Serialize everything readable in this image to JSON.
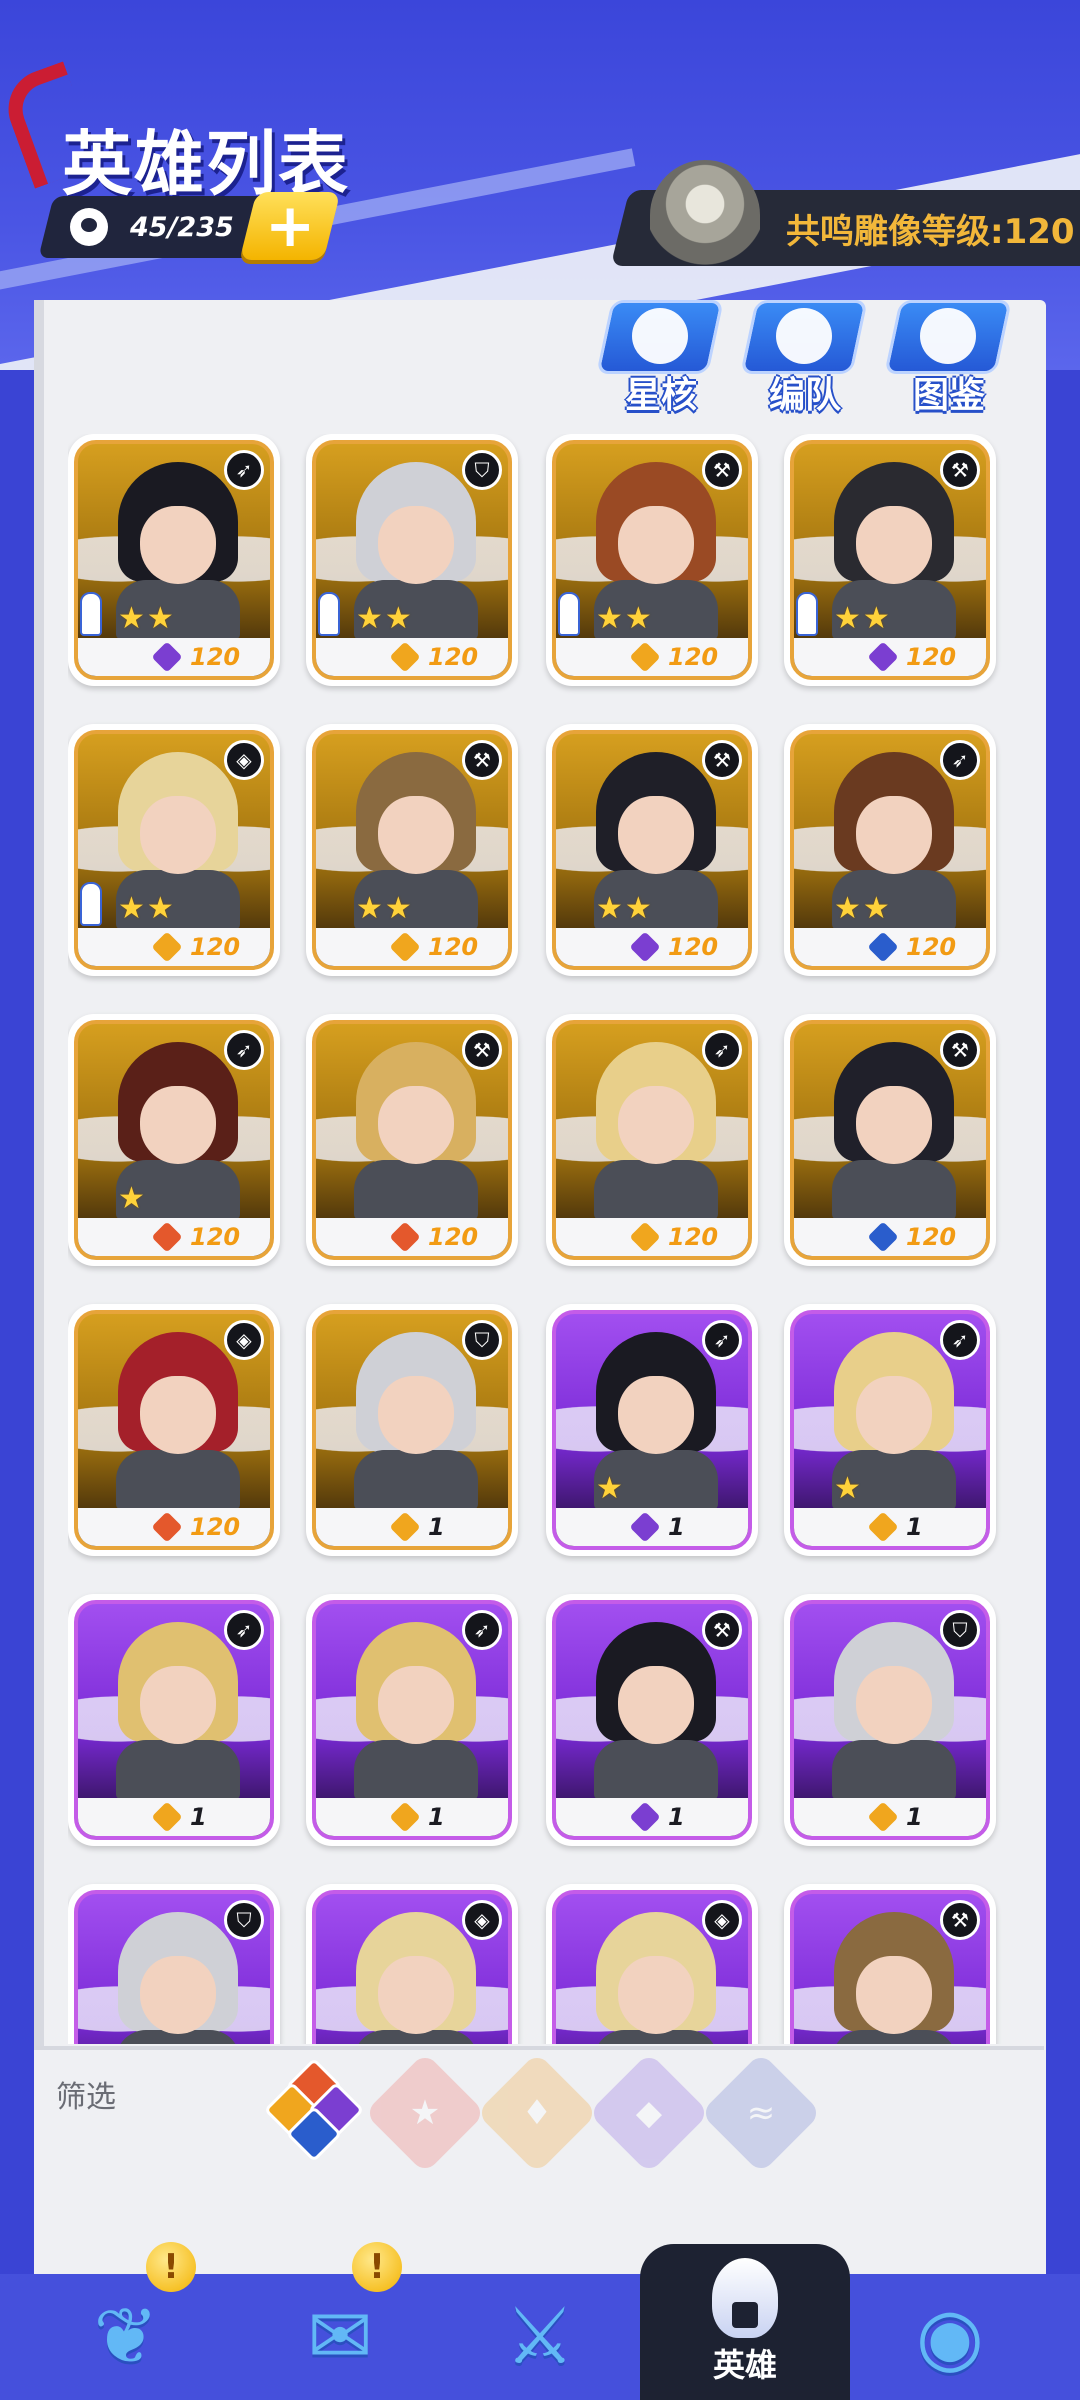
{
  "header": {
    "title": "英雄列表",
    "hero_count": "45/235",
    "plus_icon": "plus-icon",
    "statue_label": "共鸣雕像等级:120"
  },
  "top_buttons": [
    {
      "label": "星核",
      "icon": "planet-icon"
    },
    {
      "label": "编队",
      "icon": "team-icon"
    },
    {
      "label": "图鉴",
      "icon": "book-icon"
    }
  ],
  "heroes": [
    {
      "frame": "gold",
      "class_icon": "bow-icon",
      "stars": 2,
      "element": "purple",
      "level": "120",
      "locked_person": true
    },
    {
      "frame": "gold",
      "class_icon": "shield-icon",
      "stars": 2,
      "element": "gold",
      "level": "120",
      "locked_person": true
    },
    {
      "frame": "gold",
      "class_icon": "axe-icon",
      "stars": 2,
      "element": "gold",
      "level": "120",
      "locked_person": true
    },
    {
      "frame": "gold",
      "class_icon": "axe-icon",
      "stars": 2,
      "element": "purple",
      "level": "120",
      "locked_person": true
    },
    {
      "frame": "gold",
      "class_icon": "magic-icon",
      "stars": 2,
      "element": "gold",
      "level": "120",
      "locked_person": true
    },
    {
      "frame": "gold",
      "class_icon": "axe-icon",
      "stars": 2,
      "element": "gold",
      "level": "120",
      "locked_person": false
    },
    {
      "frame": "gold",
      "class_icon": "axe-icon",
      "stars": 2,
      "element": "purple",
      "level": "120",
      "locked_person": false
    },
    {
      "frame": "gold",
      "class_icon": "bow-icon",
      "stars": 2,
      "element": "blue",
      "level": "120",
      "locked_person": false
    },
    {
      "frame": "gold",
      "class_icon": "bow-icon",
      "stars": 1,
      "element": "red",
      "level": "120",
      "locked_person": false
    },
    {
      "frame": "gold",
      "class_icon": "axe-icon",
      "stars": 0,
      "element": "red",
      "level": "120",
      "locked_person": false
    },
    {
      "frame": "gold",
      "class_icon": "bow-icon",
      "stars": 0,
      "element": "gold",
      "level": "120",
      "locked_person": false
    },
    {
      "frame": "gold",
      "class_icon": "axe-icon",
      "stars": 0,
      "element": "blue",
      "level": "120",
      "locked_person": false
    },
    {
      "frame": "gold",
      "class_icon": "magic-icon",
      "stars": 0,
      "element": "red",
      "level": "120",
      "locked_person": false
    },
    {
      "frame": "gold",
      "class_icon": "shield-icon",
      "stars": 0,
      "element": "gold",
      "level": "1",
      "locked_person": false
    },
    {
      "frame": "purple",
      "class_icon": "bow-icon",
      "stars": 1,
      "element": "purple",
      "level": "1",
      "locked_person": false
    },
    {
      "frame": "purple",
      "class_icon": "bow-icon",
      "stars": 1,
      "element": "gold",
      "level": "1",
      "locked_person": false
    },
    {
      "frame": "purple",
      "class_icon": "bow-icon",
      "stars": 0,
      "element": "gold",
      "level": "1",
      "locked_person": false
    },
    {
      "frame": "purple",
      "class_icon": "bow-icon",
      "stars": 0,
      "element": "gold",
      "level": "1",
      "locked_person": false
    },
    {
      "frame": "purple",
      "class_icon": "axe-icon",
      "stars": 0,
      "element": "purple",
      "level": "1",
      "locked_person": false
    },
    {
      "frame": "purple",
      "class_icon": "shield-icon",
      "stars": 0,
      "element": "gold",
      "level": "1",
      "locked_person": false
    },
    {
      "frame": "purple",
      "class_icon": "shield-icon",
      "stars": 0,
      "element": "gold",
      "level": "",
      "locked_person": false
    },
    {
      "frame": "purple",
      "class_icon": "magic-icon",
      "stars": 0,
      "element": "gold",
      "level": "",
      "locked_person": false
    },
    {
      "frame": "purple",
      "class_icon": "magic-icon",
      "stars": 0,
      "element": "gold",
      "level": "",
      "locked_person": false
    },
    {
      "frame": "purple",
      "class_icon": "axe-icon",
      "stars": 0,
      "element": "gold",
      "level": "",
      "locked_person": false
    }
  ],
  "filter": {
    "label": "筛选",
    "options": [
      {
        "name": "all",
        "icon": "all-elements-icon",
        "active": true
      },
      {
        "name": "fire",
        "icon": "star-icon",
        "active": false
      },
      {
        "name": "light",
        "icon": "flame-icon",
        "active": false
      },
      {
        "name": "dark",
        "icon": "horns-icon",
        "active": false
      },
      {
        "name": "water",
        "icon": "wave-icon",
        "active": false
      }
    ]
  },
  "nav": {
    "items": [
      {
        "icon": "wings-icon",
        "alert": true
      },
      {
        "icon": "scroll-icon",
        "alert": true
      },
      {
        "icon": "swords-icon",
        "alert": false
      },
      {
        "icon": "helmet-icon",
        "label": "英雄",
        "active": true
      },
      {
        "icon": "stone-icon",
        "alert": false
      }
    ],
    "alert_glyph": "!"
  },
  "colors": {
    "header_blue": "#3b46da",
    "gold_frame": "#e7a43a",
    "purple_frame": "#c45ce8",
    "level_gold": "#f29b13"
  }
}
